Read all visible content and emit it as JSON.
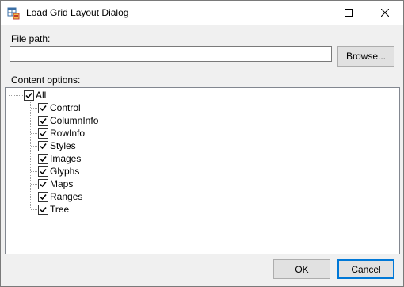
{
  "window": {
    "title": "Load Grid Layout Dialog"
  },
  "icons": {
    "app": "grid-app-icon",
    "minimize": "minimize-icon",
    "maximize": "maximize-icon",
    "close": "close-icon",
    "checkbox_checked": "checkmark-icon"
  },
  "file_path": {
    "label": "File path:",
    "value": "",
    "placeholder": ""
  },
  "browse_button": {
    "label": "Browse..."
  },
  "content_options": {
    "label": "Content options:",
    "root": {
      "label": "All",
      "checked": true
    },
    "items": [
      {
        "label": "Control",
        "checked": true
      },
      {
        "label": "ColumnInfo",
        "checked": true
      },
      {
        "label": "RowInfo",
        "checked": true
      },
      {
        "label": "Styles",
        "checked": true
      },
      {
        "label": "Images",
        "checked": true
      },
      {
        "label": "Glyphs",
        "checked": true
      },
      {
        "label": "Maps",
        "checked": true
      },
      {
        "label": "Ranges",
        "checked": true
      },
      {
        "label": "Tree",
        "checked": true
      }
    ]
  },
  "footer": {
    "ok_label": "OK",
    "cancel_label": "Cancel"
  },
  "colors": {
    "focus_border": "#0078d7",
    "dialog_bg": "#f0f0f0",
    "button_bg": "#e1e1e1"
  }
}
